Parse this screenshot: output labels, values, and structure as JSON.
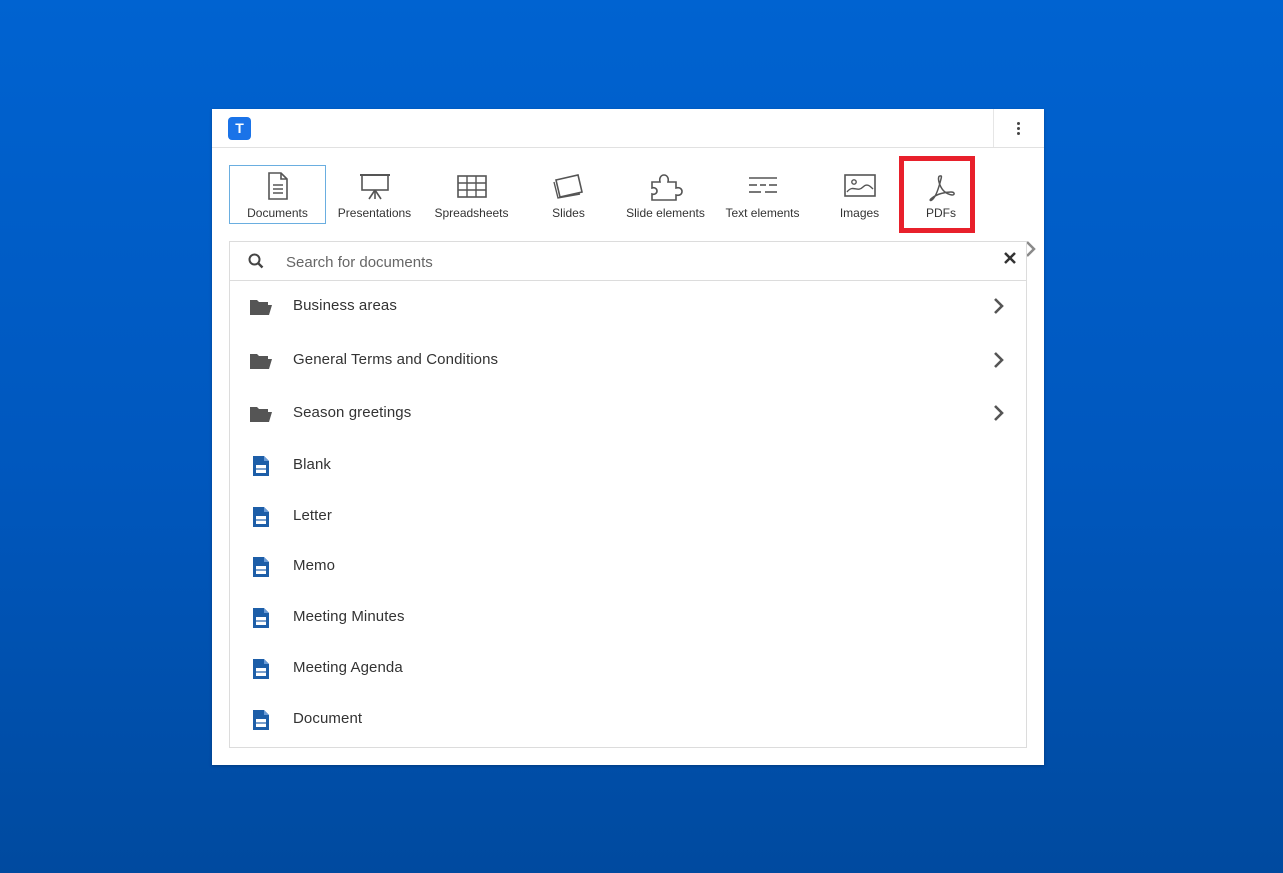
{
  "app": {
    "logo_letter": "T"
  },
  "header": {
    "menu_icon": "kebab-menu-icon"
  },
  "tabs": [
    {
      "label": "Documents",
      "icon": "document-icon",
      "active": true
    },
    {
      "label": "Presentations",
      "icon": "presentation-icon"
    },
    {
      "label": "Spreadsheets",
      "icon": "spreadsheet-icon"
    },
    {
      "label": "Slides",
      "icon": "slides-icon"
    },
    {
      "label": "Slide elements",
      "icon": "puzzle-icon"
    },
    {
      "label": "Text elements",
      "icon": "text-elements-icon"
    },
    {
      "label": "Images",
      "icon": "image-icon"
    },
    {
      "label": "PDFs",
      "icon": "pdf-icon",
      "highlighted": true
    }
  ],
  "search": {
    "placeholder": "Search for documents",
    "value": ""
  },
  "items": [
    {
      "label": "Business areas",
      "type": "folder",
      "has_children": true
    },
    {
      "label": "General Terms and Conditions",
      "type": "folder",
      "has_children": true
    },
    {
      "label": "Season greetings",
      "type": "folder",
      "has_children": true
    },
    {
      "label": "Blank",
      "type": "document"
    },
    {
      "label": "Letter",
      "type": "document"
    },
    {
      "label": "Memo",
      "type": "document"
    },
    {
      "label": "Meeting Minutes",
      "type": "document"
    },
    {
      "label": "Meeting Agenda",
      "type": "document"
    },
    {
      "label": "Document",
      "type": "document"
    }
  ],
  "colors": {
    "background": "#0060cc",
    "accent": "#1a73e8",
    "doc_icon": "#1d5ea8",
    "highlight": "#e8202b"
  }
}
